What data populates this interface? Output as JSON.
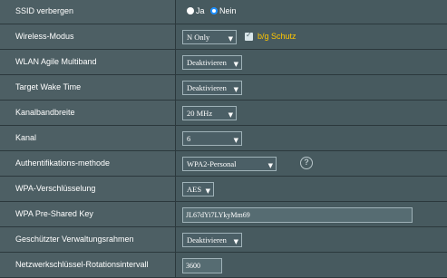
{
  "rows": [
    {
      "label": "SSID verbergen",
      "radio_yes": "Ja",
      "radio_no": "Nein"
    },
    {
      "label": "Wireless-Modus",
      "select": "N Only",
      "checkbox_label": "b/g Schutz"
    },
    {
      "label": "WLAN Agile Multiband",
      "select": "Deaktivieren"
    },
    {
      "label": "Target Wake Time",
      "select": "Deaktivieren"
    },
    {
      "label": "Kanalbandbreite",
      "select": "20 MHz"
    },
    {
      "label": "Kanal",
      "select": "6"
    },
    {
      "label": "Authentifikations-methode",
      "select": "WPA2-Personal",
      "help_icon": "question-circle-icon"
    },
    {
      "label": "WPA-Verschlüsselung",
      "select": "AES"
    },
    {
      "label": "WPA Pre-Shared Key",
      "input": "JL67dYi7LYkyMm69"
    },
    {
      "label": "Geschützter Verwaltungsrahmen",
      "select": "Deaktivieren"
    },
    {
      "label": "Netzwerkschlüssel-Rotationsintervall",
      "input": "3600"
    }
  ],
  "selected": {
    "ssid_hidden": "Nein",
    "bg_protection": true
  },
  "colors": {
    "label_bg": "#4d5f64",
    "value_bg": "#475a5f",
    "accent": "#ffc600",
    "radio_accent": "#1e90ff"
  }
}
